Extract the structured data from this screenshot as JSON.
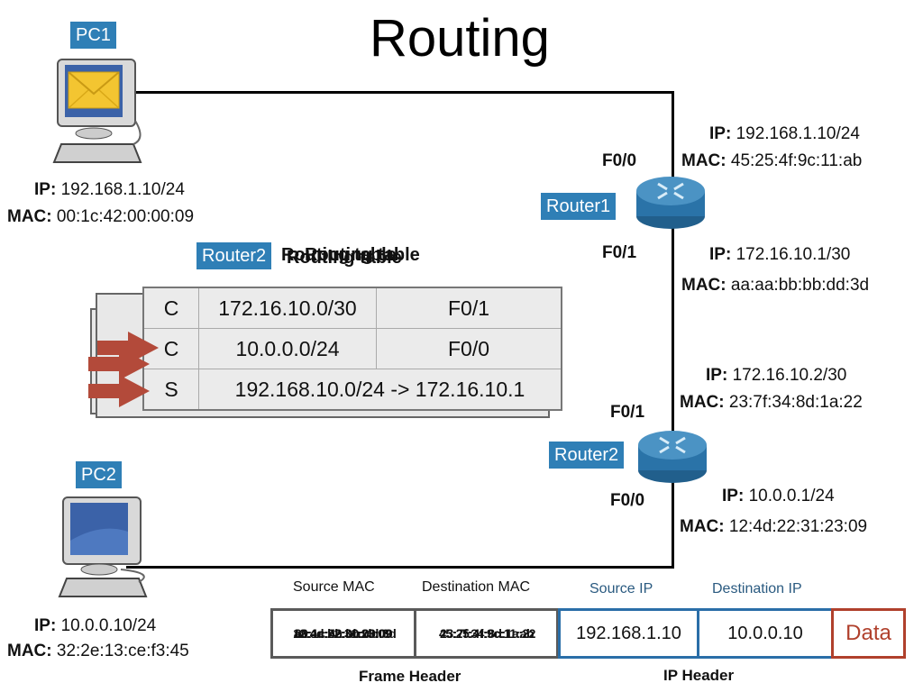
{
  "title": "Routing",
  "pc1": {
    "label": "PC1",
    "ip_key": "IP:",
    "ip": "192.168.1.10/24",
    "mac_key": "MAC:",
    "mac": "00:1c:42:00:00:09"
  },
  "pc2": {
    "label": "PC2",
    "ip_key": "IP:",
    "ip": "10.0.0.10/24",
    "mac_key": "MAC:",
    "mac": "32:2e:13:ce:f3:45"
  },
  "router1": {
    "label": "Router1",
    "f00": {
      "port": "F0/0",
      "ip_key": "IP:",
      "ip": "192.168.1.10/24",
      "mac_key": "MAC:",
      "mac": "45:25:4f:9c:11:ab"
    },
    "f01": {
      "port": "F0/1",
      "ip_key": "IP:",
      "ip": "172.16.10.1/30",
      "mac_key": "MAC:",
      "mac": "aa:aa:bb:bb:dd:3d"
    }
  },
  "router2": {
    "label": "Router2",
    "f01": {
      "port": "F0/1",
      "ip_key": "IP:",
      "ip": "172.16.10.2/30",
      "mac_key": "MAC:",
      "mac": "23:7f:34:8d:1a:22"
    },
    "f00": {
      "port": "F0/0",
      "ip_key": "IP:",
      "ip": "10.0.0.1/24",
      "mac_key": "MAC:",
      "mac": "12:4d:22:31:23:09"
    }
  },
  "routing_table": {
    "router_label": "Router2",
    "title_layers": [
      "Routing table",
      "Routing table",
      "Routing table"
    ],
    "rows": [
      {
        "type": "C",
        "network": "172.16.10.0/30",
        "iface": "F0/1"
      },
      {
        "type": "C",
        "network": "10.0.0.0/24",
        "iface": "F0/0"
      },
      {
        "type": "S",
        "route": "192.168.10.0/24 -> 172.16.10.1"
      }
    ]
  },
  "packet": {
    "headers": {
      "src_mac": "Source MAC",
      "dst_mac": "Destination MAC",
      "src_ip": "Source IP",
      "dst_ip": "Destination IP"
    },
    "src_mac_layers": [
      "00:1c:42:00:00:09",
      "aa:aa:bb:bb:dd:3d",
      "12:4d:22:31:23:09"
    ],
    "dst_mac_layers": [
      "45:25:4f:9c:11:ab",
      "23:7f:34:8d:1a:22",
      "32:2e:13:ce:f3:45"
    ],
    "src_ip": "192.168.1.10",
    "dst_ip": "10.0.0.10",
    "data": "Data",
    "frame_header": "Frame Header",
    "ip_header": "IP Header"
  },
  "colors": {
    "badge": "#2f7fb6",
    "ip_blue": "#2a6ea8",
    "data_red": "#b0402c",
    "arrow": "#b34a3a"
  }
}
